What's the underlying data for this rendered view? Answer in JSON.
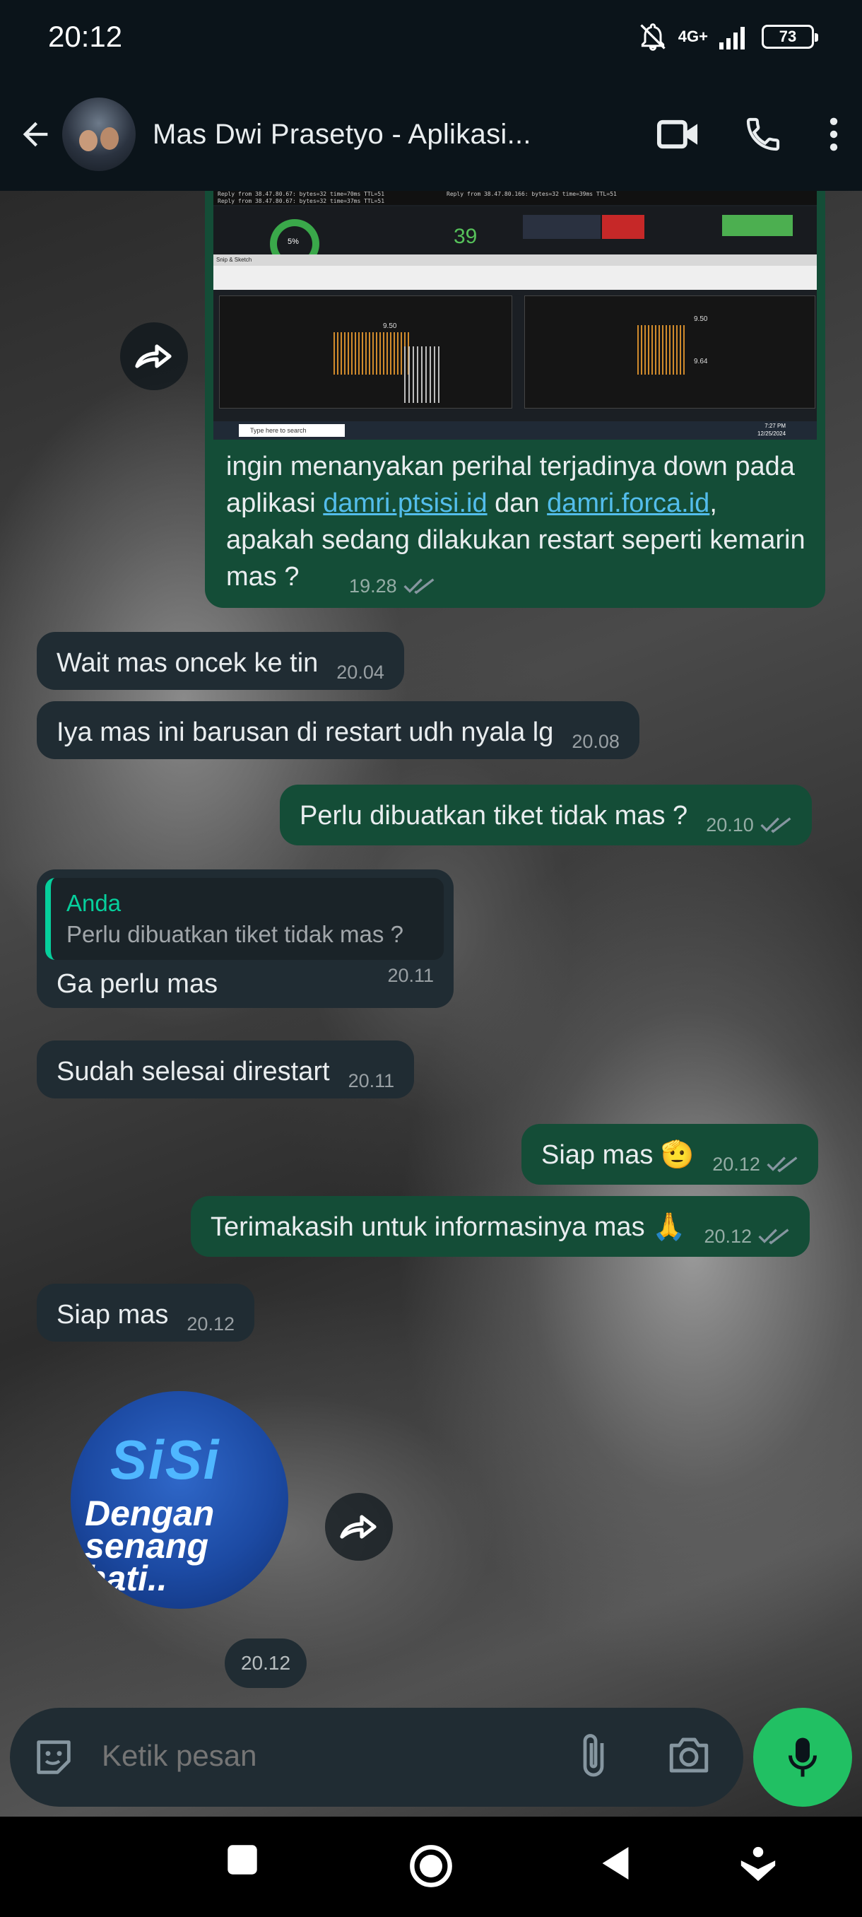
{
  "status_bar": {
    "time": "20:12",
    "network": "4G+",
    "battery": "73"
  },
  "header": {
    "title": "Mas Dwi Prasetyo - Aplikasi..."
  },
  "image_message": {
    "screenshot_texts": {
      "line1": "Reply from 38.47.80.67: bytes=32 time=70ms TTL=51",
      "line2": "Reply from 38.47.80.67: bytes=32 time=37ms TTL=51",
      "line3": "Reply from 38.47.80.166: bytes=32 time=39ms TTL=51",
      "gauge": "5%",
      "counter": "39",
      "window": "Snip & Sketch",
      "v1": "9.50",
      "v2": "9.50",
      "v3": "9.64",
      "taskbar_search": "Type here to search",
      "taskbar_time": "7:27 PM",
      "taskbar_date": "12/25/2024"
    },
    "caption_part1": "ingin menanyakan perihal terjadinya down pada aplikasi ",
    "link1": "damri.ptsisi.id",
    "caption_part2": " dan ",
    "link2": "damri.forca.id",
    "caption_part3": ", apakah sedang dilakukan restart seperti kemarin mas ?",
    "time": "19.28"
  },
  "messages": [
    {
      "text": "Wait mas oncek ke tin",
      "time": "20.04"
    },
    {
      "text": "Iya mas ini barusan di restart udh nyala lg",
      "time": "20.08"
    },
    {
      "text": "Perlu dibuatkan tiket tidak mas ?",
      "time": "20.10"
    },
    {
      "quote_name": "Anda",
      "quote_text": "Perlu dibuatkan tiket tidak mas ?",
      "text": "Ga perlu mas",
      "time": "20.11"
    },
    {
      "text": "Sudah selesai direstart",
      "time": "20.11"
    },
    {
      "text": "Siap mas 🫡",
      "time": "20.12"
    },
    {
      "text": "Terimakasih untuk informasinya mas 🙏",
      "time": "20.12"
    },
    {
      "text": "Siap mas",
      "time": "20.12"
    }
  ],
  "sticker": {
    "logo": "SiSi",
    "text": "Dengan senang hati..",
    "time": "20.12"
  },
  "composer": {
    "placeholder": "Ketik pesan"
  },
  "colors": {
    "outgoing": "#144d37",
    "incoming": "#202c33",
    "accent": "#21c063",
    "link": "#53bdeb"
  },
  "icons": [
    "back-arrow-icon",
    "video-call-icon",
    "phone-icon",
    "more-icon",
    "forward-icon",
    "emoji-icon",
    "attach-icon",
    "camera-icon",
    "mic-icon",
    "ticks-icon"
  ]
}
